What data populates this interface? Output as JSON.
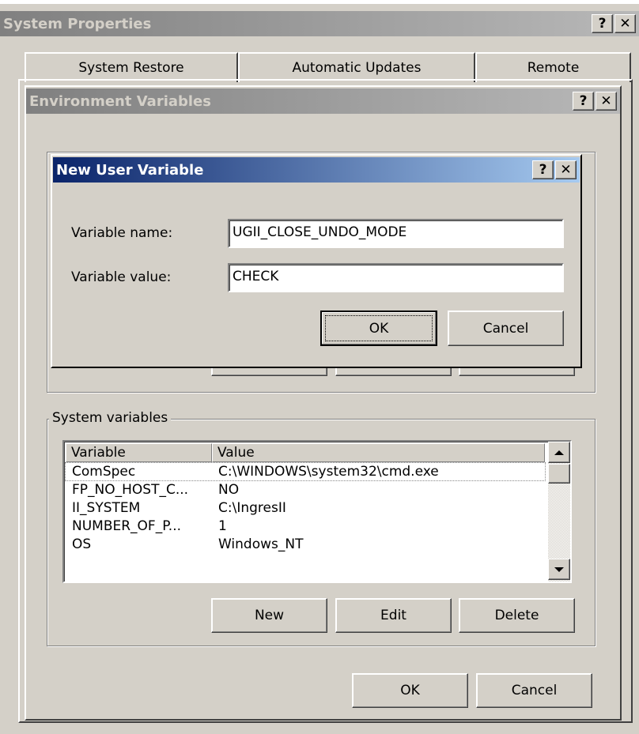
{
  "system_properties": {
    "title": "System Properties",
    "help_button": "?",
    "close_button": "✕",
    "tabs": [
      {
        "label": "System Restore"
      },
      {
        "label": "Automatic Updates"
      },
      {
        "label": "Remote"
      }
    ]
  },
  "environment_variables": {
    "title": "Environment Variables",
    "help_button": "?",
    "close_button": "✕",
    "system_variables": {
      "group_label": "System variables",
      "columns": [
        "Variable",
        "Value"
      ],
      "rows": [
        {
          "variable": "ComSpec",
          "value": "C:\\WINDOWS\\system32\\cmd.exe"
        },
        {
          "variable": "FP_NO_HOST_C...",
          "value": "NO"
        },
        {
          "variable": "II_SYSTEM",
          "value": "C:\\IngresII"
        },
        {
          "variable": "NUMBER_OF_P...",
          "value": "1"
        },
        {
          "variable": "OS",
          "value": "Windows_NT"
        }
      ],
      "buttons": {
        "new": "New",
        "edit": "Edit",
        "delete": "Delete"
      }
    },
    "buttons": {
      "ok": "OK",
      "cancel": "Cancel"
    }
  },
  "new_user_variable": {
    "title": "New User Variable",
    "help_button": "?",
    "close_button": "✕",
    "name_label": "Variable name:",
    "name_value": "UGII_CLOSE_UNDO_MODE",
    "value_label": "Variable value:",
    "value_value": "CHECK",
    "buttons": {
      "ok": "OK",
      "cancel": "Cancel"
    }
  },
  "colors": {
    "face": "#d4d0c8",
    "active_title": "#0a246a",
    "inactive_title": "#808080"
  }
}
